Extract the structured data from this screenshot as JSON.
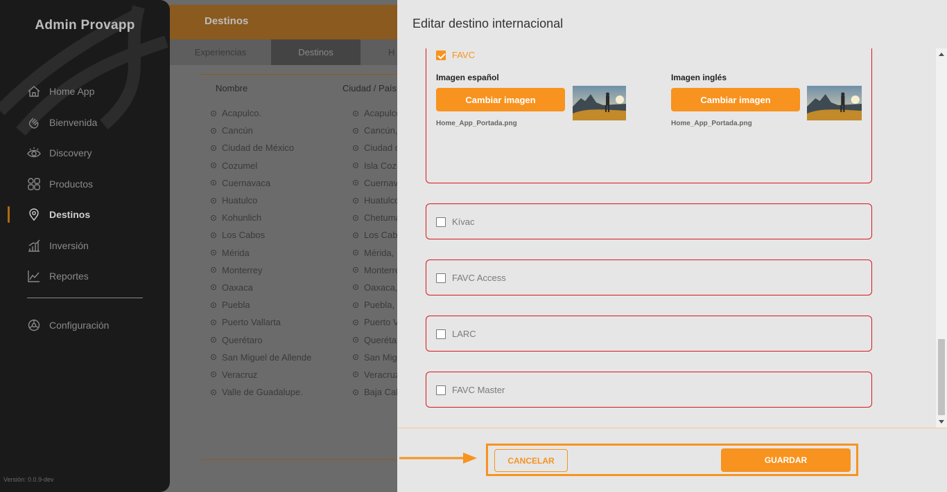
{
  "app": {
    "brand": "Admin Provapp",
    "version": "Versión: 0.0.9-dev"
  },
  "sidebar": {
    "items": [
      {
        "label": "Home App",
        "icon": "home-icon"
      },
      {
        "label": "Bienvenida",
        "icon": "wave-hand-icon"
      },
      {
        "label": "Discovery",
        "icon": "eye-icon"
      },
      {
        "label": "Productos",
        "icon": "grid-icon"
      },
      {
        "label": "Destinos",
        "icon": "location-pin-icon",
        "active": true
      },
      {
        "label": "Inversión",
        "icon": "bar-chart-icon"
      },
      {
        "label": "Reportes",
        "icon": "trend-chart-icon"
      }
    ],
    "config": {
      "label": "Configuración",
      "icon": "settings-icon"
    }
  },
  "page": {
    "title": "Destinos",
    "tabs": [
      "Experiencias",
      "Destinos",
      "H"
    ],
    "table": {
      "headers": [
        "Nombre",
        "Ciudad / País"
      ],
      "names": [
        "Acapulco.",
        "Cancún",
        "Ciudad de México",
        "Cozumel",
        "Cuernavaca",
        "Huatulco",
        "Kohunlich",
        "Los Cabos",
        "Mérida",
        "Monterrey",
        "Oaxaca",
        "Puebla",
        "Puerto Vallarta",
        "Querétaro",
        "San Miguel de Allende",
        "Veracruz",
        "Valle de Guadalupe."
      ],
      "cities": [
        "Acapulco",
        "Cancún,",
        "Ciudad d",
        "Isla Cozu",
        "Cuernava",
        "Huatulco",
        "Chetuma",
        "Los Cab",
        "Mérida,",
        "Monterre",
        "Oaxaca,",
        "Puebla,",
        "Puerto V",
        "Querétar",
        "San Mig",
        "Veracruz",
        "Baja Cal"
      ]
    }
  },
  "modal": {
    "title": "Editar destino internacional",
    "expanded_card": {
      "label": "FAVC",
      "checked": true,
      "spanish": {
        "label": "Imagen español",
        "button": "Cambiar imagen",
        "file": "Home_App_Portada.png"
      },
      "english": {
        "label": "Imagen inglés",
        "button": "Cambiar imagen",
        "file": "Home_App_Portada.png"
      }
    },
    "options": [
      {
        "label": "Kívac",
        "checked": false
      },
      {
        "label": "FAVC Access",
        "checked": false
      },
      {
        "label": "LARC",
        "checked": false
      },
      {
        "label": "FAVC Master",
        "checked": false
      }
    ],
    "footer": {
      "cancel": "CANCELAR",
      "save": "GUARDAR"
    }
  },
  "colors": {
    "accent": "#f7931e",
    "card_border": "#d9161d",
    "sidebar_bg": "#1a1a1a",
    "modal_bg": "#e6e6e6"
  }
}
